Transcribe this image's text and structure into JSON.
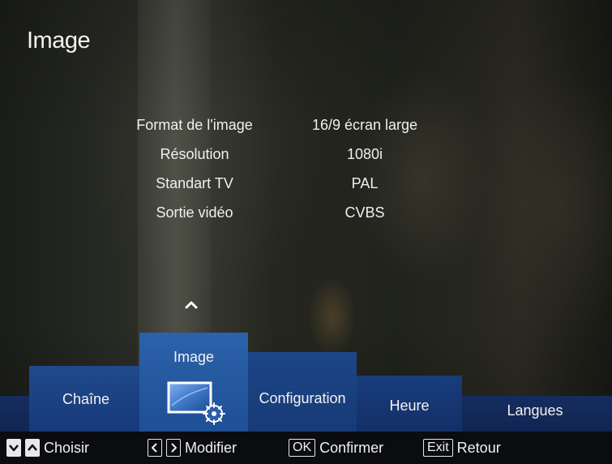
{
  "title": "Image",
  "settings": [
    {
      "label": "Format de l'image",
      "value": "16/9 écran large"
    },
    {
      "label": "Résolution",
      "value": "1080i"
    },
    {
      "label": "Standart TV",
      "value": "PAL"
    },
    {
      "label": "Sortie vidéo",
      "value": "CVBS"
    }
  ],
  "menu": {
    "selected": "Image",
    "tabs": [
      {
        "id": "chaine",
        "label": "Chaîne"
      },
      {
        "id": "image",
        "label": "Image"
      },
      {
        "id": "config",
        "label": "Configuration"
      },
      {
        "id": "heure",
        "label": "Heure"
      },
      {
        "id": "langues",
        "label": "Langues"
      }
    ]
  },
  "footer": {
    "choose": {
      "label": "Choisir",
      "keys": [
        "chevron-down-icon",
        "chevron-up-icon"
      ]
    },
    "modify": {
      "label": "Modifier",
      "keys": [
        "chevron-left-icon",
        "chevron-right-icon"
      ]
    },
    "confirm": {
      "key": "OK",
      "label": "Confirmer"
    },
    "back": {
      "key": "Exit",
      "label": "Retour"
    }
  },
  "colors": {
    "selected_tab": "#2b62aa",
    "tab": "#1f4a8b",
    "band": "#152d5e",
    "footer": "#0a0c10",
    "text": "#f0f0f0"
  }
}
